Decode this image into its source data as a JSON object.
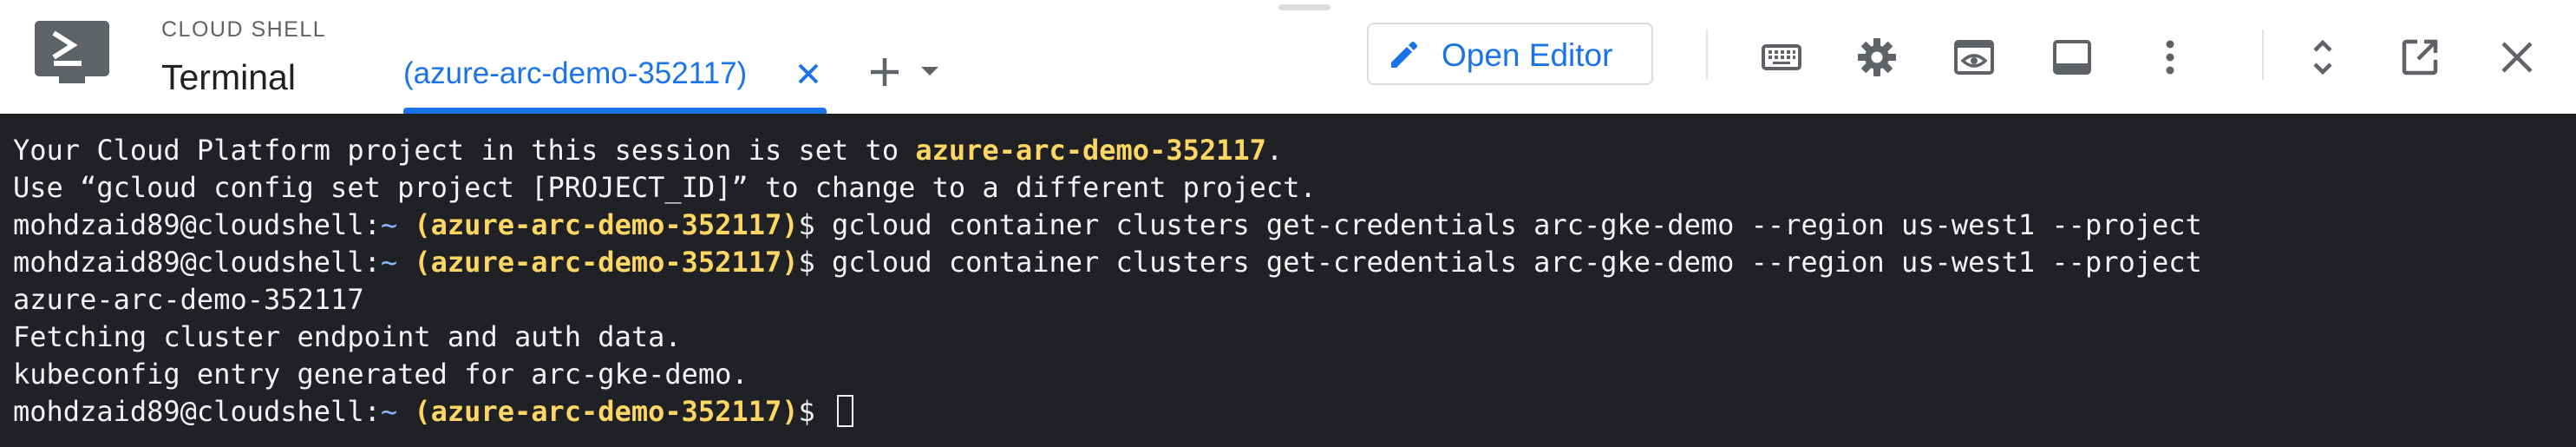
{
  "header": {
    "section_label": "CLOUD SHELL",
    "title": "Terminal",
    "tab": {
      "label": "(azure-arc-demo-352117)"
    },
    "open_editor_label": "Open Editor"
  },
  "terminal": {
    "lines": [
      {
        "pre": "Your Cloud Platform project in this session is set to ",
        "project": "azure-arc-demo-352117",
        "post": "."
      },
      {
        "text": "Use “gcloud config set project [PROJECT_ID]” to change to a different project."
      },
      {
        "user": "mohdzaid89@cloudshell",
        "sep": ":",
        "path": "~",
        "project": "(azure-arc-demo-352117)",
        "cmd": "$ gcloud container clusters get-credentials arc-gke-demo --region us-west1 --project"
      },
      {
        "user": "mohdzaid89@cloudshell",
        "sep": ":",
        "path": "~",
        "project": "(azure-arc-demo-352117)",
        "cmd": "$ gcloud container clusters get-credentials arc-gke-demo --region us-west1 --project"
      },
      {
        "text": "azure-arc-demo-352117"
      },
      {
        "text": "Fetching cluster endpoint and auth data."
      },
      {
        "text": "kubeconfig entry generated for arc-gke-demo."
      },
      {
        "user": "mohdzaid89@cloudshell",
        "sep": ":",
        "path": "~",
        "project": "(azure-arc-demo-352117)",
        "cmd": "$ "
      }
    ]
  },
  "icons": [
    "terminal-logo-icon",
    "close-icon",
    "add-icon",
    "chevron-down-icon",
    "pencil-icon",
    "keyboard-icon",
    "gear-icon",
    "web-preview-icon",
    "panel-icon",
    "more-vert-icon",
    "unfold-icon",
    "open-in-new-icon",
    "close-icon"
  ],
  "colors": {
    "accent": "#1a73e8",
    "terminal_bg": "#202124",
    "prompt_project": "#fdd663",
    "prompt_path": "#8ab4f8"
  }
}
